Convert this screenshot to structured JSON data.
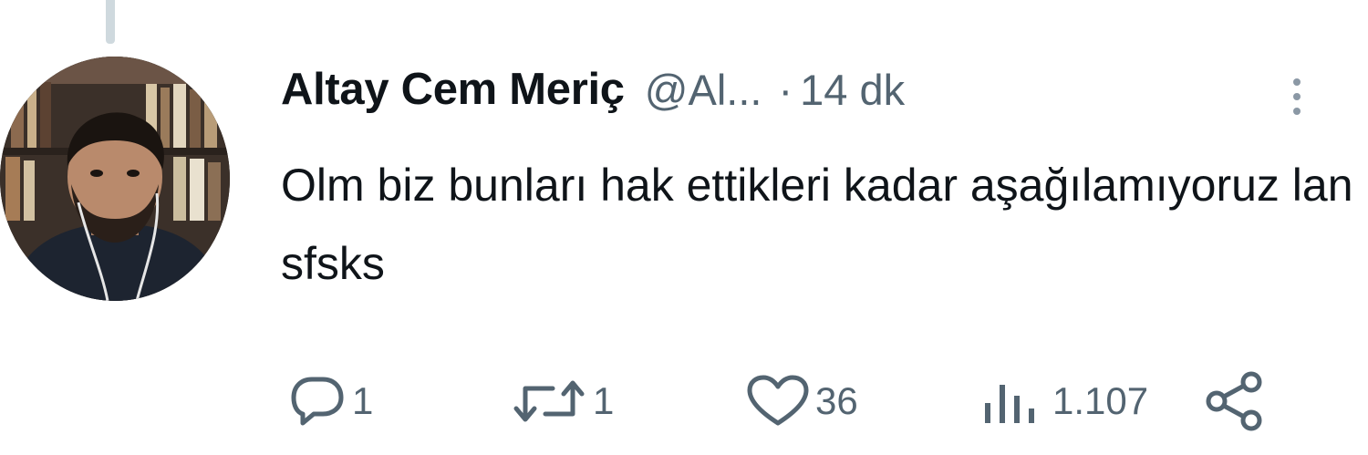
{
  "tweet": {
    "author_name": "Altay Cem Meriç",
    "author_handle": "@Al...",
    "separator": "·",
    "time": "14 dk",
    "text": "Olm biz bunları hak ettikleri kadar aşağılamıyoruz lan sfsks"
  },
  "actions": {
    "reply_count": "1",
    "retweet_count": "1",
    "like_count": "36",
    "views_count": "1.107"
  },
  "icons": {
    "reply": "reply-icon",
    "retweet": "retweet-icon",
    "like": "heart-icon",
    "views": "views-icon",
    "share": "share-icon",
    "more": "more-options-icon"
  },
  "colors": {
    "text": "#0f1419",
    "secondary": "#536471",
    "thread_line": "#cfd9de"
  }
}
